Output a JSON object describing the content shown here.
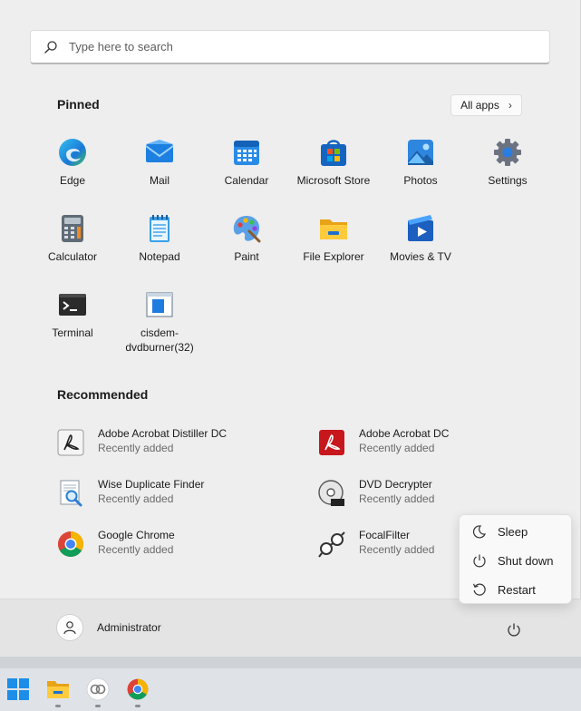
{
  "search": {
    "placeholder": "Type here to search"
  },
  "pinned": {
    "title": "Pinned",
    "all_apps_label": "All apps",
    "items": [
      {
        "label": "Edge",
        "icon": "edge-icon"
      },
      {
        "label": "Mail",
        "icon": "mail-icon"
      },
      {
        "label": "Calendar",
        "icon": "calendar-icon"
      },
      {
        "label": "Microsoft Store",
        "icon": "store-icon"
      },
      {
        "label": "Photos",
        "icon": "photos-icon"
      },
      {
        "label": "Settings",
        "icon": "settings-icon"
      },
      {
        "label": "Calculator",
        "icon": "calculator-icon"
      },
      {
        "label": "Notepad",
        "icon": "notepad-icon"
      },
      {
        "label": "Paint",
        "icon": "paint-icon"
      },
      {
        "label": "File Explorer",
        "icon": "folder-icon"
      },
      {
        "label": "Movies & TV",
        "icon": "movies-icon"
      },
      {
        "label": "",
        "icon": ""
      },
      {
        "label": "Terminal",
        "icon": "terminal-icon"
      },
      {
        "label": "cisdem-dvdburner(32)",
        "icon": "dvdburner-icon"
      }
    ]
  },
  "recommended": {
    "title": "Recommended",
    "items": [
      {
        "name": "Adobe Acrobat Distiller DC",
        "sub": "Recently added",
        "icon": "acrobat-distiller-icon"
      },
      {
        "name": "Adobe Acrobat DC",
        "sub": "Recently added",
        "icon": "acrobat-icon"
      },
      {
        "name": "Wise Duplicate Finder",
        "sub": "Recently added",
        "icon": "duplicate-finder-icon"
      },
      {
        "name": "DVD Decrypter",
        "sub": "Recently added",
        "icon": "dvd-decrypter-icon"
      },
      {
        "name": "Google Chrome",
        "sub": "Recently added",
        "icon": "chrome-icon"
      },
      {
        "name": "FocalFilter",
        "sub": "Recently added",
        "icon": "focalfilter-icon"
      }
    ]
  },
  "power_menu": {
    "items": [
      {
        "label": "Sleep",
        "icon": "sleep-icon"
      },
      {
        "label": "Shut down",
        "icon": "power-icon"
      },
      {
        "label": "Restart",
        "icon": "restart-icon"
      }
    ]
  },
  "user": {
    "name": "Administrator"
  },
  "colors": {
    "accent": "#0a64c8",
    "menu_bg": "#eeeeee",
    "footer_bg": "#e4e4e4",
    "taskbar_bg": "#dfe3e8"
  }
}
